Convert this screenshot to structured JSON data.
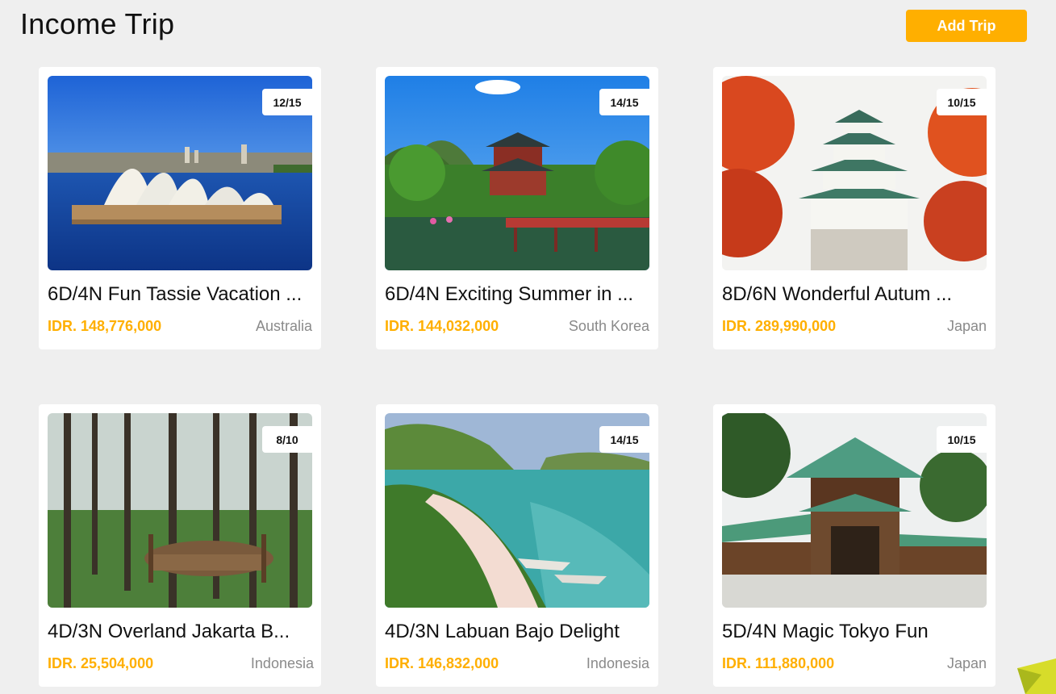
{
  "header": {
    "title": "Income Trip",
    "add_button": "Add Trip"
  },
  "trips": [
    {
      "title": "6D/4N Fun Tassie Vacation ...",
      "price": "IDR. 148,776,000",
      "country": "Australia",
      "quota": "12/15",
      "image": "sydney-opera-house"
    },
    {
      "title": "6D/4N Exciting Summer in ...",
      "price": "IDR. 144,032,000",
      "country": "South Korea",
      "quota": "14/15",
      "image": "korean-pavilion"
    },
    {
      "title": "8D/6N Wonderful Autum ...",
      "price": "IDR. 289,990,000",
      "country": "Japan",
      "quota": "10/15",
      "image": "japanese-castle-autumn"
    },
    {
      "title": "4D/3N Overland Jakarta B...",
      "price": "IDR. 25,504,000",
      "country": "Indonesia",
      "quota": "8/10",
      "image": "pine-forest-treehouse"
    },
    {
      "title": "4D/3N Labuan Bajo Delight",
      "price": "IDR. 146,832,000",
      "country": "Indonesia",
      "quota": "14/15",
      "image": "pink-beach-labuan-bajo"
    },
    {
      "title": "5D/4N Magic Tokyo Fun",
      "price": "IDR. 111,880,000",
      "country": "Japan",
      "quota": "10/15",
      "image": "meiji-shrine-gate"
    }
  ],
  "colors": {
    "accent": "#ffaf00",
    "background": "#efefef",
    "muted_text": "#8a8a8a"
  }
}
